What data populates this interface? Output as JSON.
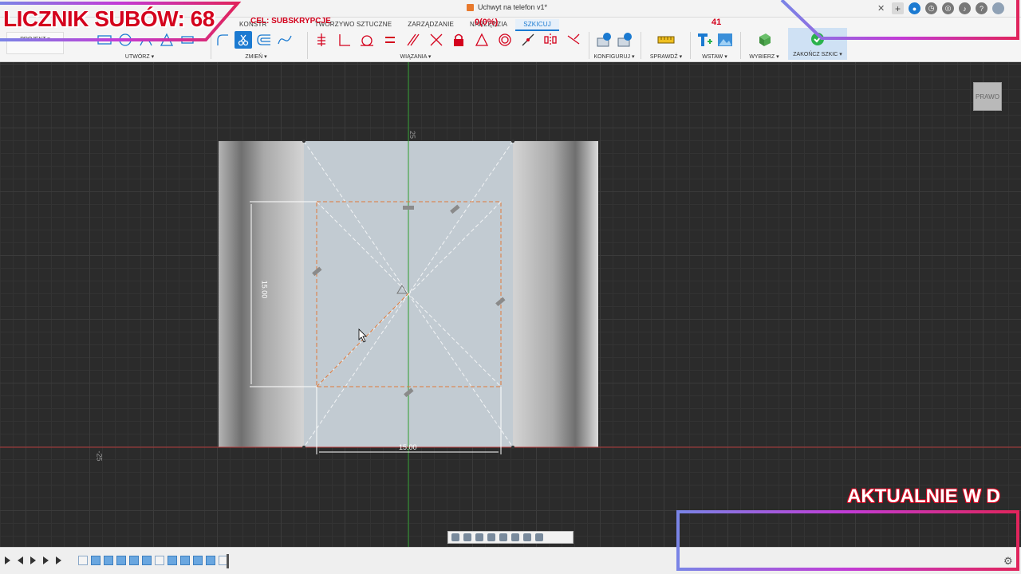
{
  "app": {
    "document_title": "Uchwyt na telefon v1*"
  },
  "ribbon": {
    "project_label": "PROJEKT ▾",
    "tabs": [
      {
        "label": "KONSTR",
        "active": false
      },
      {
        "label": "TWORZYWO SZTUCZNE",
        "active": false
      },
      {
        "label": "ZARZĄDZANIE",
        "active": false
      },
      {
        "label": "NARZĘDZIA",
        "active": false
      },
      {
        "label": "SZKICUJ",
        "active": true
      }
    ],
    "groups": {
      "create": "UTWÓRZ ▾",
      "modify": "ZMIEŃ ▾",
      "constraints": "WIĄZANIA ▾",
      "configure": "KONFIGURUJ ▾",
      "inspect": "SPRAWDŹ ▾",
      "insert": "WSTAW ▾",
      "select": "WYBIERZ ▾",
      "finish": "ZAKOŃCZ SZKIC ▾"
    }
  },
  "canvas": {
    "axis_label_negative": "-25",
    "axis_label_positive": "25",
    "dimension_vertical": "15.00",
    "dimension_horizontal": "15.00",
    "view_cube_label": "PRAWO"
  },
  "overlay": {
    "subs_counter": "LICZNIK SUBÓW: 68",
    "goal_text": "CEL: SUBSKRYPCJE",
    "goal_progress": "0(0%)",
    "goal_count": "41",
    "now_live": "AKTUALNIE W D"
  },
  "colors": {
    "accent": "#1b7ad1",
    "overlay_red": "#d4021d",
    "canvas_bg": "#2b2b2b",
    "sketch_dashed": "#e07a3a"
  }
}
